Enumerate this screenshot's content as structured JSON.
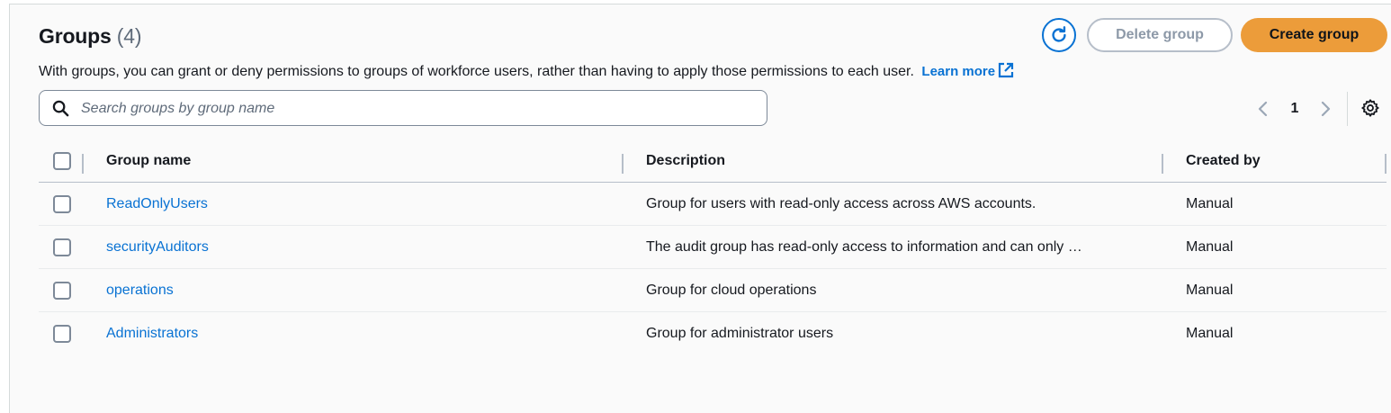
{
  "header": {
    "title": "Groups",
    "count": "(4)",
    "description": "With groups, you can grant or deny permissions to groups of workforce users, rather than having to apply those permissions to each user.",
    "learn_more": "Learn more"
  },
  "actions": {
    "delete_label": "Delete group",
    "create_label": "Create group"
  },
  "search": {
    "placeholder": "Search groups by group name",
    "value": ""
  },
  "pagination": {
    "current_page": "1"
  },
  "table": {
    "columns": [
      "Group name",
      "Description",
      "Created by"
    ],
    "rows": [
      {
        "name": "ReadOnlyUsers",
        "description": "Group for users with read-only access across AWS accounts.",
        "created_by": "Manual"
      },
      {
        "name": "securityAuditors",
        "description": "The audit group has read-only access to information and can only …",
        "created_by": "Manual"
      },
      {
        "name": "operations",
        "description": "Group for cloud operations",
        "created_by": "Manual"
      },
      {
        "name": "Administrators",
        "description": "Group for administrator users",
        "created_by": "Manual"
      }
    ]
  },
  "colors": {
    "primary_button": "#ec9c3a",
    "link": "#0972d3",
    "disabled_text": "#8d99a8"
  },
  "icons": {
    "refresh": "refresh-icon",
    "search": "search-icon",
    "external": "external-link-icon",
    "prev": "chevron-left-icon",
    "next": "chevron-right-icon",
    "settings": "gear-icon"
  }
}
